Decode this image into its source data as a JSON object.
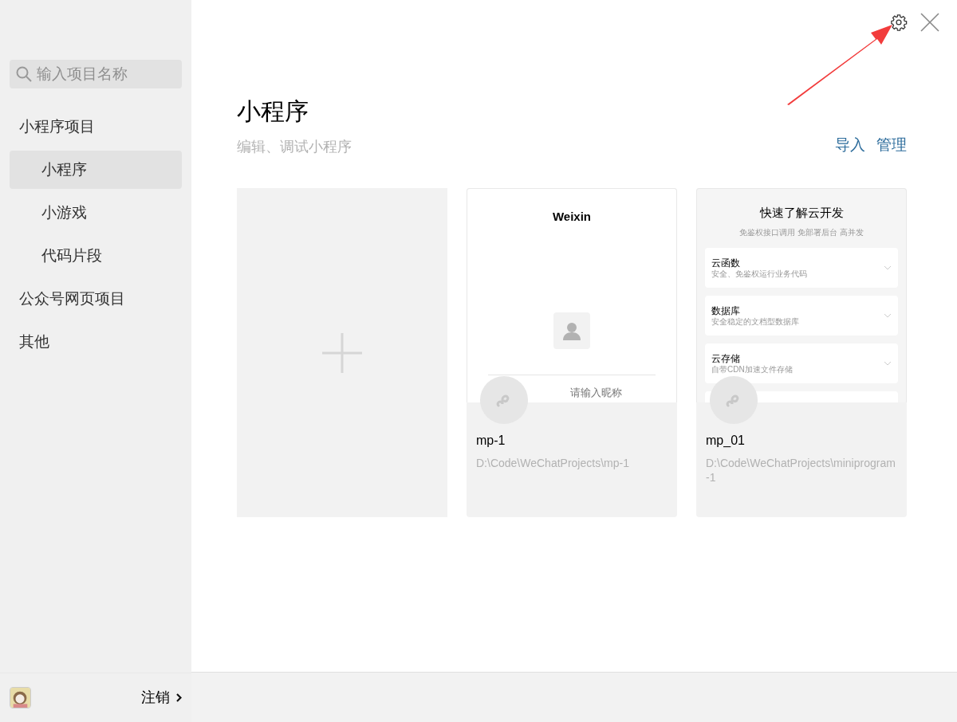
{
  "sidebar": {
    "search": {
      "placeholder": "输入项目名称"
    },
    "nav": [
      {
        "label": "小程序项目",
        "selected": false,
        "children": [
          {
            "label": "小程序",
            "selected": true
          },
          {
            "label": "小游戏",
            "selected": false
          },
          {
            "label": "代码片段",
            "selected": false
          }
        ]
      },
      {
        "label": "公众号网页项目",
        "selected": false
      },
      {
        "label": "其他",
        "selected": false
      }
    ],
    "footer": {
      "logout": "注销"
    }
  },
  "header": {
    "title": "小程序",
    "subtitle": "编辑、调试小程序",
    "actions": [
      "导入",
      "管理"
    ]
  },
  "projects": [
    {
      "kind": "new"
    },
    {
      "kind": "weixin",
      "name": "mp-1",
      "path": "D:\\Code\\WeChatProjects\\mp-1",
      "preview": {
        "title": "Weixin",
        "placeholder": "请输入昵称"
      }
    },
    {
      "kind": "cloud",
      "name": "mp_01",
      "path": "D:\\Code\\WeChatProjects\\miniprogram-1",
      "preview": {
        "title": "快速了解云开发",
        "subtitle": "免鉴权接口调用 免部署后台 高并发",
        "items": [
          {
            "title": "云函数",
            "desc": "安全、免鉴权运行业务代码"
          },
          {
            "title": "数据库",
            "desc": "安全稳定的文档型数据库"
          },
          {
            "title": "云存储",
            "desc": "自带CDN加速文件存储"
          }
        ]
      }
    }
  ]
}
